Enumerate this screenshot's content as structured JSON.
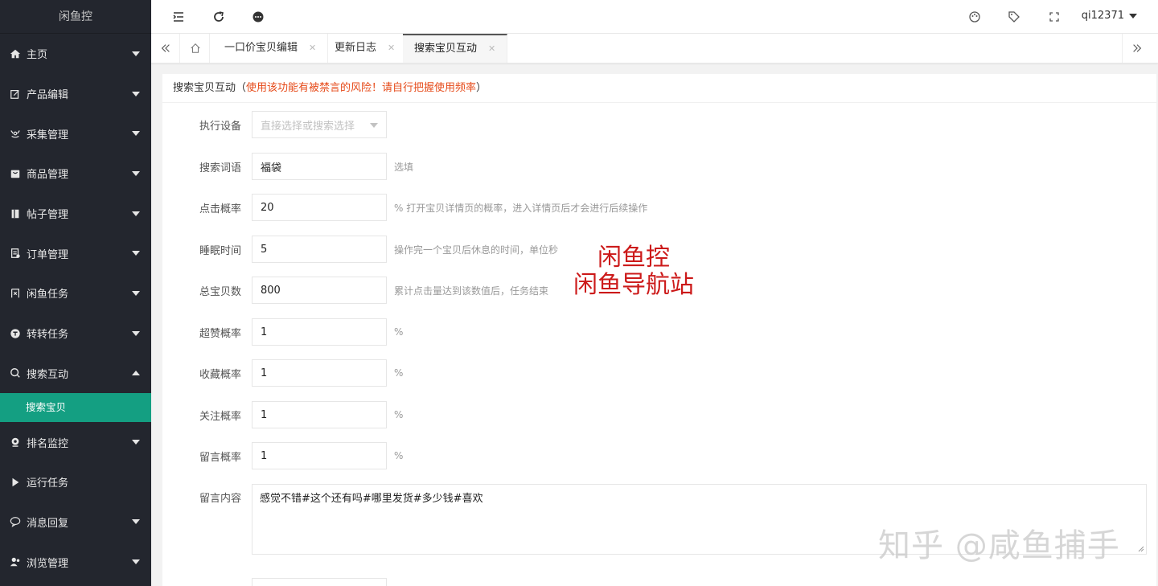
{
  "app": {
    "logo": "闲鱼控"
  },
  "sidebar": {
    "items": [
      {
        "label": "主页",
        "icon": "home-icon"
      },
      {
        "label": "产品编辑",
        "icon": "edit-icon"
      },
      {
        "label": "采集管理",
        "icon": "collect-icon"
      },
      {
        "label": "商品管理",
        "icon": "goods-icon"
      },
      {
        "label": "帖子管理",
        "icon": "post-icon"
      },
      {
        "label": "订单管理",
        "icon": "order-icon"
      },
      {
        "label": "闲鱼任务",
        "icon": "fish-task-icon"
      },
      {
        "label": "转转任务",
        "icon": "zhuanzhuan-icon"
      },
      {
        "label": "搜索互动",
        "icon": "search-icon"
      },
      {
        "label": "排名监控",
        "icon": "rank-icon"
      },
      {
        "label": "运行任务",
        "icon": "play-icon"
      },
      {
        "label": "消息回复",
        "icon": "message-icon"
      },
      {
        "label": "浏览管理",
        "icon": "browse-icon"
      }
    ],
    "active_sub": "搜索宝贝"
  },
  "header": {
    "user": "qi12371",
    "icons": [
      "menu-fold-icon",
      "refresh-icon",
      "chat-icon",
      "theme-icon",
      "tag-icon",
      "fullscreen-icon"
    ]
  },
  "tabs": [
    {
      "label": "一口价宝贝编辑"
    },
    {
      "label": "更新日志"
    },
    {
      "label": "搜索宝贝互动",
      "active": true
    }
  ],
  "card": {
    "title": "搜索宝贝互动（",
    "warning": "使用该功能有被禁言的风险！请自行把握使用频率",
    "title_end": "）"
  },
  "form": {
    "device": {
      "label": "执行设备",
      "placeholder": "直接选择或搜索选择"
    },
    "keyword": {
      "label": "搜索词语",
      "value": "福袋",
      "hint": "选填"
    },
    "click_rate": {
      "label": "点击概率",
      "value": "20",
      "hint": "% 打开宝贝详情页的概率，进入详情页后才会进行后续操作"
    },
    "sleep": {
      "label": "睡眠时间",
      "value": "5",
      "hint": "操作完一个宝贝后休息的时间，单位秒"
    },
    "total": {
      "label": "总宝贝数",
      "value": "800",
      "hint": "累计点击量达到该数值后，任务结束"
    },
    "like_rate": {
      "label": "超赞概率",
      "value": "1",
      "hint": "%"
    },
    "fav_rate": {
      "label": "收藏概率",
      "value": "1",
      "hint": "%"
    },
    "follow_rate": {
      "label": "关注概率",
      "value": "1",
      "hint": "%"
    },
    "comment_rate": {
      "label": "留言概率",
      "value": "1",
      "hint": "%"
    },
    "comment_content": {
      "label": "留言内容",
      "value": "感觉不错#这个还有吗#哪里发货#多少钱#喜欢"
    }
  },
  "overlay": {
    "line1": "闲鱼控",
    "line2": "闲鱼导航站"
  },
  "watermark": "知乎 @咸鱼捕手",
  "colors": {
    "sidebar_bg": "#23262e",
    "active_green": "#149f82",
    "warning": "#e64a19",
    "overlay_red": "#cc1a1a"
  }
}
